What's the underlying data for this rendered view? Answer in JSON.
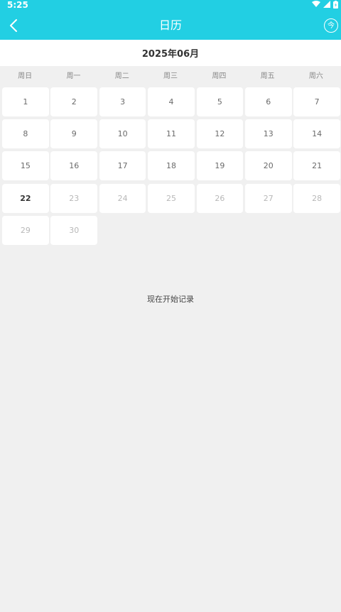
{
  "status_bar": {
    "time": "5:25",
    "icons": [
      "wifi-icon",
      "cellular-signal-icon",
      "battery-charging-icon"
    ]
  },
  "header": {
    "title": "日历",
    "back_icon": "chevron-left-icon",
    "today_label": "今"
  },
  "calendar": {
    "month_label": "2025年06月",
    "weekdays": [
      "周日",
      "周一",
      "周二",
      "周三",
      "周四",
      "周五",
      "周六"
    ],
    "days": [
      "1",
      "2",
      "3",
      "4",
      "5",
      "6",
      "7",
      "8",
      "9",
      "10",
      "11",
      "12",
      "13",
      "14",
      "15",
      "16",
      "17",
      "18",
      "19",
      "20",
      "21",
      "22",
      "23",
      "24",
      "25",
      "26",
      "27",
      "28",
      "29",
      "30"
    ],
    "today": "22"
  },
  "empty_state": {
    "message": "现在开始记录"
  },
  "colors": {
    "accent": "#22cfe3",
    "background": "#f0f0f0",
    "cell": "#ffffff",
    "day_text": "#6b6b6b",
    "future_day_text": "#b8b8b8"
  }
}
